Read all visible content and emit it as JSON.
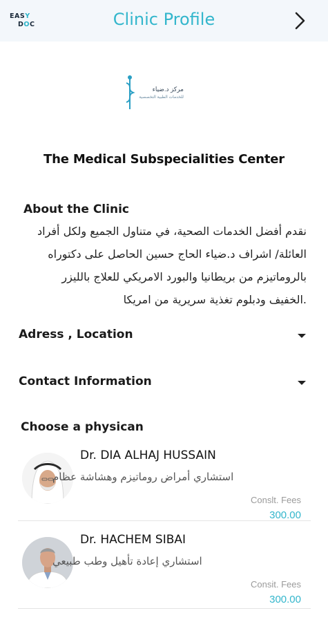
{
  "header": {
    "logo_text": "EASYDOC",
    "title": "Clinic Profile",
    "next_icon": "chevron-right-icon"
  },
  "clinic": {
    "logo_arabic": "مركز د.ضياء",
    "logo_arabic_sub": "للخدمات الطبية التخصصية",
    "name": "The Medical Subspecialities Center"
  },
  "about": {
    "heading": "About the Clinic",
    "line1": "نقدم أفضل الخدمات الصحية، في متناول الجميع ولكل أفراد",
    "line2": "العائلة/ اشراف د.ضياء الحاج حسين الحاصل على دكتوراه",
    "line3": "بالروماتيزم من بريطانيا والبورد الامريكي للعلاج بالليزر",
    "line4": ".الخفيف ودبلوم تغذية سريرية من امريكا"
  },
  "sections": {
    "address_label": "Adress , Location",
    "contact_label": "Contact Information"
  },
  "physicians": {
    "heading": "Choose a physican",
    "items": [
      {
        "name": "Dr. DIA ALHAJ HUSSAIN",
        "specialty": "استشاري أمراض روماتيزم وهشاشة عظام",
        "fees_label": "Conslt. Fees",
        "fees": "300.00"
      },
      {
        "name": "Dr. HACHEM SIBAI",
        "specialty": "استشاري إعادة تأهيل وطب طبيعي",
        "fees_label": "Consit. Fees",
        "fees": "300.00"
      }
    ]
  },
  "colors": {
    "accent": "#33b6cc",
    "header_bg": "#f3f7fb"
  }
}
